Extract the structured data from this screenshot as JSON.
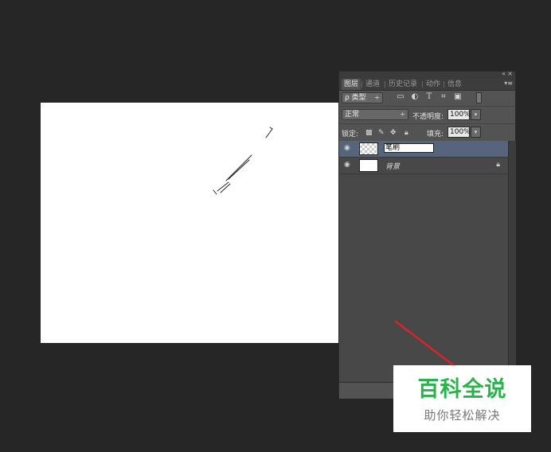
{
  "layers_panel": {
    "top_controls": {
      "collapse_icon": "«",
      "close_icon": "×"
    },
    "tabs": [
      {
        "label": "图层",
        "active": true
      },
      {
        "label": "通道",
        "active": false
      },
      {
        "label": "历史记录",
        "active": false
      },
      {
        "label": "动作",
        "active": false
      },
      {
        "label": "信息",
        "active": false
      }
    ],
    "tab_menu_icon": "▾≡",
    "filter": {
      "label": "ρ 类型",
      "arrow": "÷"
    },
    "filter_icons": [
      "image-filter-icon",
      "adjustment-filter-icon",
      "type-filter-icon",
      "shape-filter-icon",
      "smart-object-filter-icon"
    ],
    "blend_mode": {
      "value": "正常",
      "arrow": "÷"
    },
    "opacity": {
      "label": "不透明度:",
      "value": "100%",
      "button": "▾"
    },
    "lock": {
      "label": "锁定:"
    },
    "fill": {
      "label": "填充:",
      "value": "100%",
      "button": "▾"
    },
    "layers": [
      {
        "name": "笔刷",
        "editing": true,
        "selected": true,
        "thumbnail": "transparent"
      },
      {
        "name": "背景",
        "editing": false,
        "selected": false,
        "thumbnail": "white",
        "locked": true
      }
    ]
  },
  "watermark": {
    "title": "百科全说",
    "subtitle": "助你轻松解决"
  },
  "colors": {
    "app_bg": "#262626",
    "panel_bg": "#535353",
    "selected_row": "#56657a",
    "annotation_arrow": "#d8232a",
    "watermark_green": "#2bb24c"
  }
}
